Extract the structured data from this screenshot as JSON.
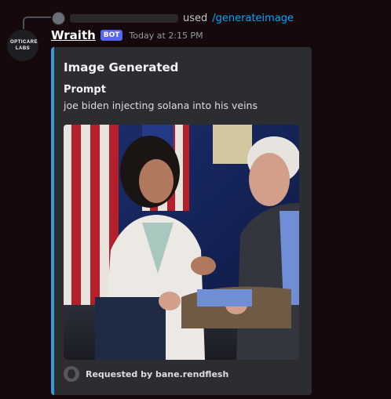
{
  "reply": {
    "used_text": "used",
    "command": "/generateimage"
  },
  "message": {
    "author": "Wraith",
    "bot_badge": "BOT",
    "timestamp": "Today at 2:15 PM",
    "avatar_text": "OPTICARE LABS"
  },
  "embed": {
    "accent_color": "#3498db",
    "title": "Image Generated",
    "field_name": "Prompt",
    "field_value": "joe biden injecting solana into his veins",
    "footer_text": "Requested by bane.rendflesh"
  }
}
